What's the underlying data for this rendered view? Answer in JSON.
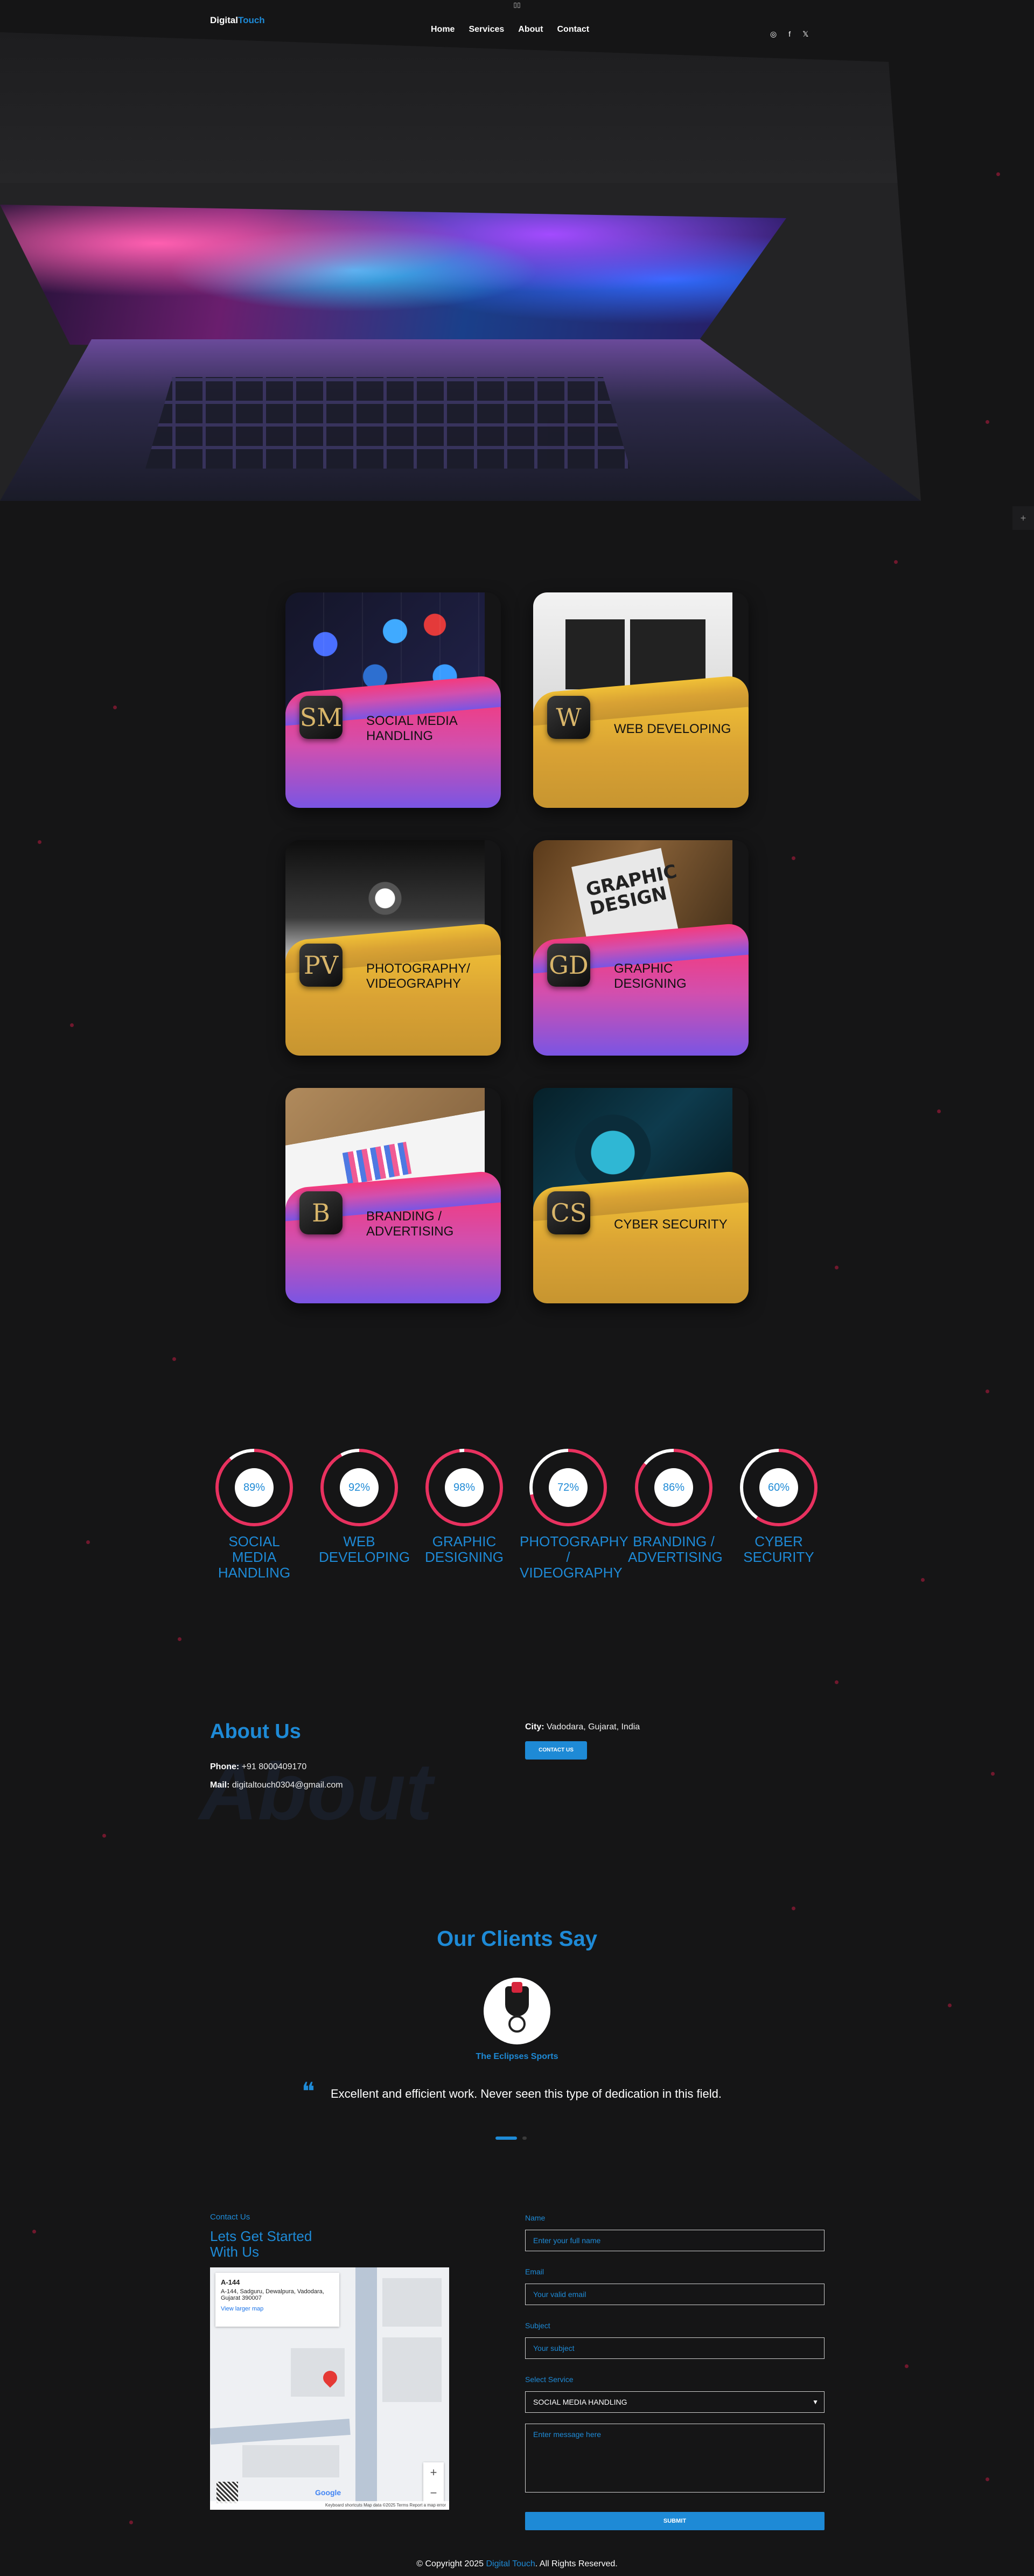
{
  "header": {
    "logo_main": "Digital",
    "logo_accent": "Touch",
    "nav": [
      "Home",
      "Services",
      "About",
      "Contact"
    ],
    "top_badge": "▯▯",
    "social_icons": [
      "instagram-icon",
      "facebook-icon",
      "twitter-icon"
    ],
    "social_glyphs": [
      "◎",
      "f",
      "𝕏"
    ]
  },
  "side_button": "+",
  "services": [
    {
      "monogram": "SM",
      "label": "SOCIAL MEDIA HANDLING",
      "theme": "pink"
    },
    {
      "monogram": "W",
      "label": "WEB DEVELOPING",
      "theme": "gold"
    },
    {
      "monogram": "PV",
      "label": "PHOTOGRAPHY/ VIDEOGRAPHY",
      "theme": "gold"
    },
    {
      "monogram": "GD",
      "label": "GRAPHIC DESIGNING",
      "theme": "pink"
    },
    {
      "monogram": "B",
      "label": "BRANDING / ADVERTISING",
      "theme": "pink"
    },
    {
      "monogram": "CS",
      "label": "CYBER SECURITY",
      "theme": "gold"
    }
  ],
  "book_text": "GRAPHIC DESIGN",
  "skills": [
    {
      "percent": 89,
      "value": "89%",
      "name": "SOCIAL MEDIA HANDLING"
    },
    {
      "percent": 92,
      "value": "92%",
      "name": "WEB DEVELOPING"
    },
    {
      "percent": 98,
      "value": "98%",
      "name": "GRAPHIC DESIGNING"
    },
    {
      "percent": 72,
      "value": "72%",
      "name": "PHOTOGRAPHY / VIDEOGRAPHY"
    },
    {
      "percent": 86,
      "value": "86%",
      "name": "BRANDING / ADVERTISING"
    },
    {
      "percent": 60,
      "value": "60%",
      "name": "CYBER SECURITY"
    }
  ],
  "about": {
    "title": "About Us",
    "watermark": "About",
    "phone_label": "Phone:",
    "phone": "+91 8000409170",
    "mail_label": "Mail:",
    "mail": "digitaltouch0304@gmail.com",
    "city_label": "City:",
    "city": "Vadodara, Gujarat, India",
    "contact_button": "CONTACT US"
  },
  "testimonials": {
    "title": "Our Clients Say",
    "client": "The Eclipses Sports",
    "quote_mark": "❝",
    "text": "Excellent and efficient work. Never seen this type of dedication in this field."
  },
  "contact": {
    "small": "Contact Us",
    "heading": "Lets Get Started With Us",
    "map": {
      "title": "A-144",
      "address": "A-144, Sadguru, Dewalpura, Vadodara, Gujarat 390007",
      "link": "View larger map",
      "footer": "Keyboard shortcuts   Map data ©2025   Terms   Report a map error",
      "google": "Google"
    },
    "fields": {
      "name_label": "Name",
      "name_placeholder": "Enter your full name",
      "email_label": "Email",
      "email_placeholder": "Your valid email",
      "subject_label": "Subject",
      "subject_placeholder": "Your subject",
      "service_label": "Select Service",
      "service_value": "SOCIAL MEDIA HANDLING",
      "message_placeholder": "Enter message here"
    },
    "submit": "SUBMIT"
  },
  "footer": {
    "prefix": "© Copyright 2025 ",
    "brand": "Digital Touch",
    "suffix": ". All Rights Reserved."
  },
  "colors": {
    "accent": "#1e8ad6",
    "background": "#151516",
    "pink": "#f43a7d",
    "gold": "#e2ad34",
    "ring": "#e8315f"
  }
}
